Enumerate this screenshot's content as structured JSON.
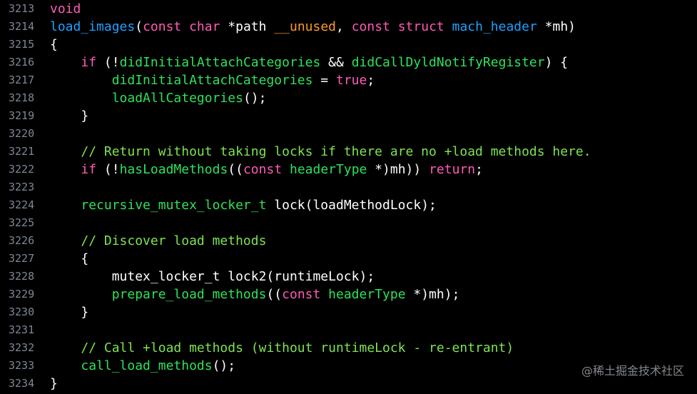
{
  "colors": {
    "background": "#000000",
    "line_number": "#7f8795",
    "keyword": "#ff5bb6",
    "function": "#2fe15b",
    "type": "#1fa1ff",
    "identifier": "#a6ff5b",
    "plain": "#ffffff",
    "comment": "#7ee352",
    "param": "#ff9a2d"
  },
  "lines": [
    {
      "no": "3213",
      "tokens": [
        {
          "t": "void",
          "k": "keyword"
        }
      ]
    },
    {
      "no": "3214",
      "tokens": [
        {
          "t": "load_images",
          "k": "type"
        },
        {
          "t": "(",
          "k": "plain"
        },
        {
          "t": "const",
          "k": "keyword"
        },
        {
          "t": " ",
          "k": "plain"
        },
        {
          "t": "char",
          "k": "keyword"
        },
        {
          "t": " *path ",
          "k": "plain"
        },
        {
          "t": "__unused",
          "k": "param"
        },
        {
          "t": ", ",
          "k": "plain"
        },
        {
          "t": "const",
          "k": "keyword"
        },
        {
          "t": " ",
          "k": "plain"
        },
        {
          "t": "struct",
          "k": "keyword"
        },
        {
          "t": " ",
          "k": "plain"
        },
        {
          "t": "mach_header",
          "k": "type"
        },
        {
          "t": " *mh)",
          "k": "plain"
        }
      ]
    },
    {
      "no": "3215",
      "tokens": [
        {
          "t": "{",
          "k": "plain"
        }
      ]
    },
    {
      "no": "3216",
      "tokens": [
        {
          "t": "    ",
          "k": "plain"
        },
        {
          "t": "if",
          "k": "keyword"
        },
        {
          "t": " (!",
          "k": "plain"
        },
        {
          "t": "didInitialAttachCategories",
          "k": "function"
        },
        {
          "t": " && ",
          "k": "plain"
        },
        {
          "t": "didCallDyldNotifyRegister",
          "k": "function"
        },
        {
          "t": ") {",
          "k": "plain"
        }
      ]
    },
    {
      "no": "3217",
      "tokens": [
        {
          "t": "        ",
          "k": "plain"
        },
        {
          "t": "didInitialAttachCategories",
          "k": "function"
        },
        {
          "t": " = ",
          "k": "plain"
        },
        {
          "t": "true",
          "k": "keyword"
        },
        {
          "t": ";",
          "k": "plain"
        }
      ]
    },
    {
      "no": "3218",
      "tokens": [
        {
          "t": "        ",
          "k": "plain"
        },
        {
          "t": "loadAllCategories",
          "k": "function"
        },
        {
          "t": "();",
          "k": "plain"
        }
      ]
    },
    {
      "no": "3219",
      "tokens": [
        {
          "t": "    }",
          "k": "plain"
        }
      ]
    },
    {
      "no": "3220",
      "tokens": []
    },
    {
      "no": "3221",
      "tokens": [
        {
          "t": "    ",
          "k": "plain"
        },
        {
          "t": "// Return without taking locks if there are no +load methods here.",
          "k": "comment"
        }
      ]
    },
    {
      "no": "3222",
      "tokens": [
        {
          "t": "    ",
          "k": "plain"
        },
        {
          "t": "if",
          "k": "keyword"
        },
        {
          "t": " (!",
          "k": "plain"
        },
        {
          "t": "hasLoadMethods",
          "k": "function"
        },
        {
          "t": "((",
          "k": "plain"
        },
        {
          "t": "const",
          "k": "keyword"
        },
        {
          "t": " ",
          "k": "plain"
        },
        {
          "t": "headerType",
          "k": "function"
        },
        {
          "t": " *)mh)) ",
          "k": "plain"
        },
        {
          "t": "return",
          "k": "keyword"
        },
        {
          "t": ";",
          "k": "plain"
        }
      ]
    },
    {
      "no": "3223",
      "tokens": []
    },
    {
      "no": "3224",
      "tokens": [
        {
          "t": "    ",
          "k": "plain"
        },
        {
          "t": "recursive_mutex_locker_t",
          "k": "function"
        },
        {
          "t": " lock(loadMethodLock);",
          "k": "plain"
        }
      ]
    },
    {
      "no": "3225",
      "tokens": []
    },
    {
      "no": "3226",
      "tokens": [
        {
          "t": "    ",
          "k": "plain"
        },
        {
          "t": "// Discover load methods",
          "k": "comment"
        }
      ]
    },
    {
      "no": "3227",
      "tokens": [
        {
          "t": "    {",
          "k": "plain"
        }
      ]
    },
    {
      "no": "3228",
      "tokens": [
        {
          "t": "        mutex_locker_t lock2(runtimeLock);",
          "k": "plain"
        }
      ]
    },
    {
      "no": "3229",
      "tokens": [
        {
          "t": "        ",
          "k": "plain"
        },
        {
          "t": "prepare_load_methods",
          "k": "function"
        },
        {
          "t": "((",
          "k": "plain"
        },
        {
          "t": "const",
          "k": "keyword"
        },
        {
          "t": " ",
          "k": "plain"
        },
        {
          "t": "headerType",
          "k": "function"
        },
        {
          "t": " *)mh);",
          "k": "plain"
        }
      ]
    },
    {
      "no": "3230",
      "tokens": [
        {
          "t": "    }",
          "k": "plain"
        }
      ]
    },
    {
      "no": "3231",
      "tokens": []
    },
    {
      "no": "3232",
      "tokens": [
        {
          "t": "    ",
          "k": "plain"
        },
        {
          "t": "// Call +load methods (without runtimeLock - re-entrant)",
          "k": "comment"
        }
      ]
    },
    {
      "no": "3233",
      "tokens": [
        {
          "t": "    ",
          "k": "plain"
        },
        {
          "t": "call_load_methods",
          "k": "function"
        },
        {
          "t": "();",
          "k": "plain"
        }
      ]
    },
    {
      "no": "3234",
      "tokens": [
        {
          "t": "}",
          "k": "plain"
        }
      ]
    }
  ],
  "watermark": "@稀土掘金技术社区"
}
